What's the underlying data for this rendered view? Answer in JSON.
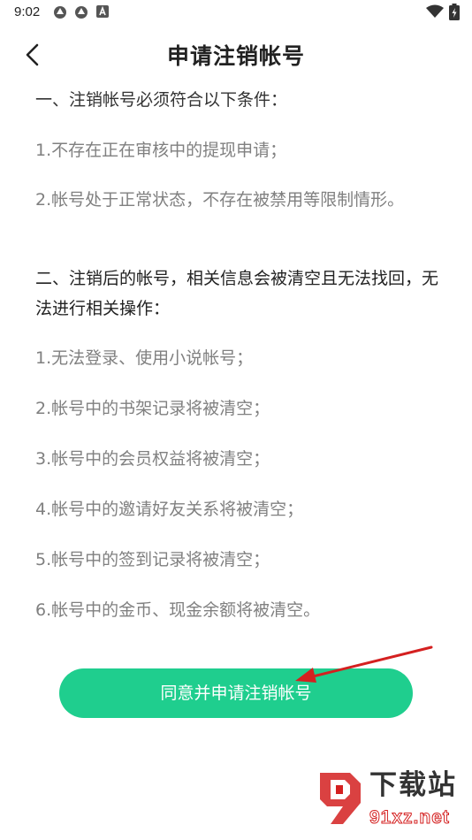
{
  "status_bar": {
    "time": "9:02"
  },
  "header": {
    "title": "申请注销帐号"
  },
  "content": {
    "section1_title": "一、注销帐号必须符合以下条件：",
    "section1_items": [
      "1.不存在正在审核中的提现申请；",
      "2.帐号处于正常状态，不存在被禁用等限制情形。"
    ],
    "section2_title": "二、注销后的帐号，相关信息会被清空且无法找回，无法进行相关操作：",
    "section2_items": [
      "1.无法登录、使用小说帐号；",
      "2.帐号中的书架记录将被清空；",
      "3.帐号中的会员权益将被清空；",
      "4.帐号中的邀请好友关系将被清空；",
      "5.帐号中的签到记录将被清空；",
      "6.帐号中的金币、现金余额将被清空。"
    ]
  },
  "agree_button": {
    "label": "同意并申请注销帐号"
  },
  "colors": {
    "accent": "#1fce8e",
    "annotation_arrow": "#d42020"
  },
  "watermark": {
    "line1": "下载站",
    "line2": "91xz.net"
  }
}
